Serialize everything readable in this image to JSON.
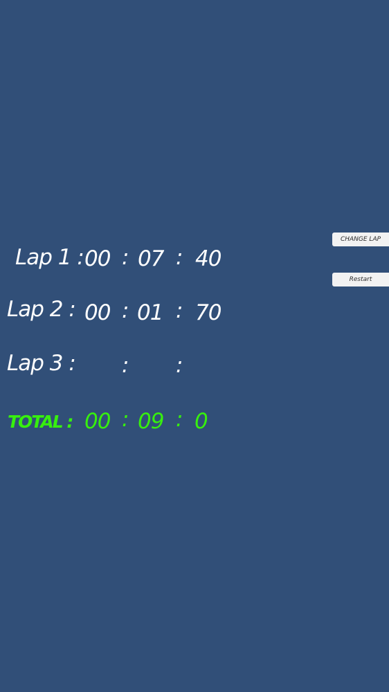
{
  "colors": {
    "background": "#314f78",
    "text": "#ffffff",
    "total": "#37f00e",
    "button_bg": "#f2f2f2",
    "button_text": "#2a2a2a"
  },
  "laps": [
    {
      "label": "Lap 1 :",
      "min": "00",
      "sep1": ":",
      "sec": "07",
      "sep2": ":",
      "ms": "40"
    },
    {
      "label": "Lap 2 :",
      "min": "00",
      "sep1": ":",
      "sec": "01",
      "sep2": ":",
      "ms": "70"
    },
    {
      "label": "Lap 3 :",
      "min": "",
      "sep1": ":",
      "sec": "",
      "sep2": ":",
      "ms": ""
    }
  ],
  "total": {
    "label": "TOTAL :",
    "min": "00",
    "sep1": ":",
    "sec": "09",
    "sep2": ":",
    "ms": "0"
  },
  "buttons": {
    "change_lap": "change lap",
    "restart": "Restart"
  }
}
